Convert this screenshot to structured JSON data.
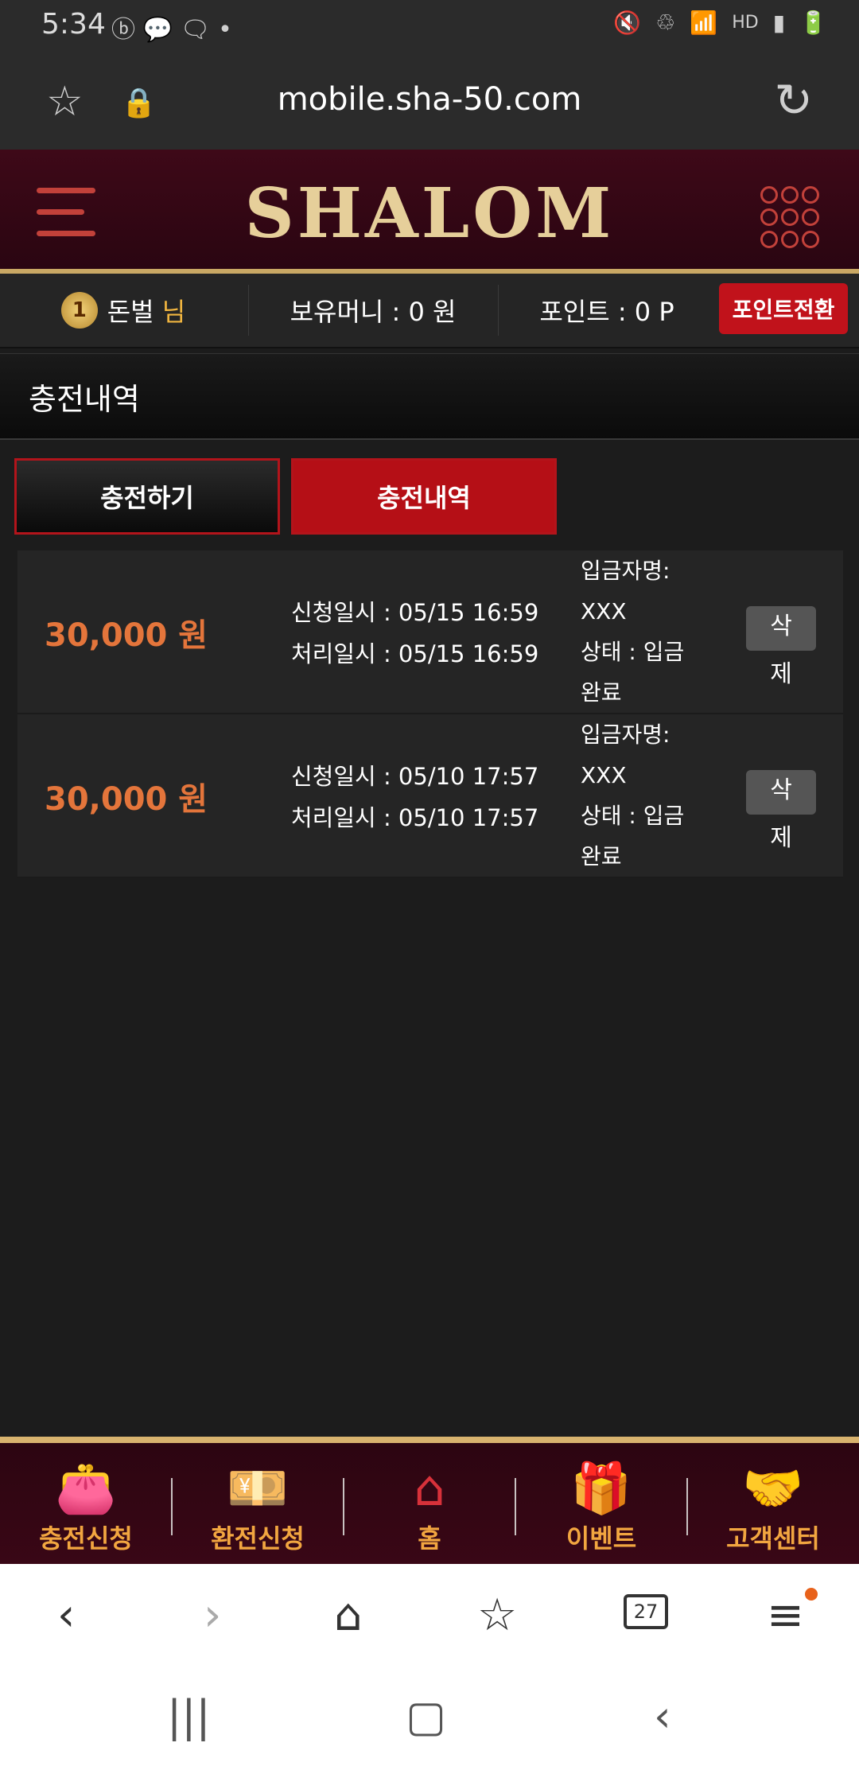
{
  "status_bar": {
    "time": "5:34",
    "hd_text": "HD"
  },
  "url_bar": {
    "url": "mobile.sha-50.com"
  },
  "header": {
    "logo_text": "SHALOM"
  },
  "user_bar": {
    "rank_number": "1",
    "username": "돈벌",
    "honorific": "님",
    "money": "보유머니 : 0 원",
    "points": "포인트 : 0 P",
    "convert_label": "포인트전환"
  },
  "section": {
    "title": "충전내역"
  },
  "tabs": [
    {
      "label": "충전하기"
    },
    {
      "label": "충전내역"
    }
  ],
  "records": [
    {
      "amount": "30,000 원",
      "request_time": "신청일시 : 05/15 16:59",
      "process_time": "처리일시 : 05/15 16:59",
      "depositor_label": "입금자명:",
      "depositor": "XXX",
      "status_label": "상태 : 입금",
      "status_value": "완료",
      "delete_top": "삭",
      "delete_bottom": "제"
    },
    {
      "amount": "30,000 원",
      "request_time": "신청일시 : 05/10 17:57",
      "process_time": "처리일시 : 05/10 17:57",
      "depositor_label": "입금자명:",
      "depositor": "XXX",
      "status_label": "상태 : 입금",
      "status_value": "완료",
      "delete_top": "삭",
      "delete_bottom": "제"
    }
  ],
  "bottom_nav": [
    {
      "label": "충전신청",
      "icon": "wallet-icon"
    },
    {
      "label": "환전신청",
      "icon": "exchange-icon"
    },
    {
      "label": "홈",
      "icon": "home-icon"
    },
    {
      "label": "이벤트",
      "icon": "gift-icon"
    },
    {
      "label": "고객센터",
      "icon": "handshake-icon"
    }
  ],
  "browser_bar": {
    "tab_count": "27"
  },
  "colors": {
    "accent_red": "#b50f16",
    "gold": "#c9a864",
    "amount_orange": "#e4753b"
  }
}
